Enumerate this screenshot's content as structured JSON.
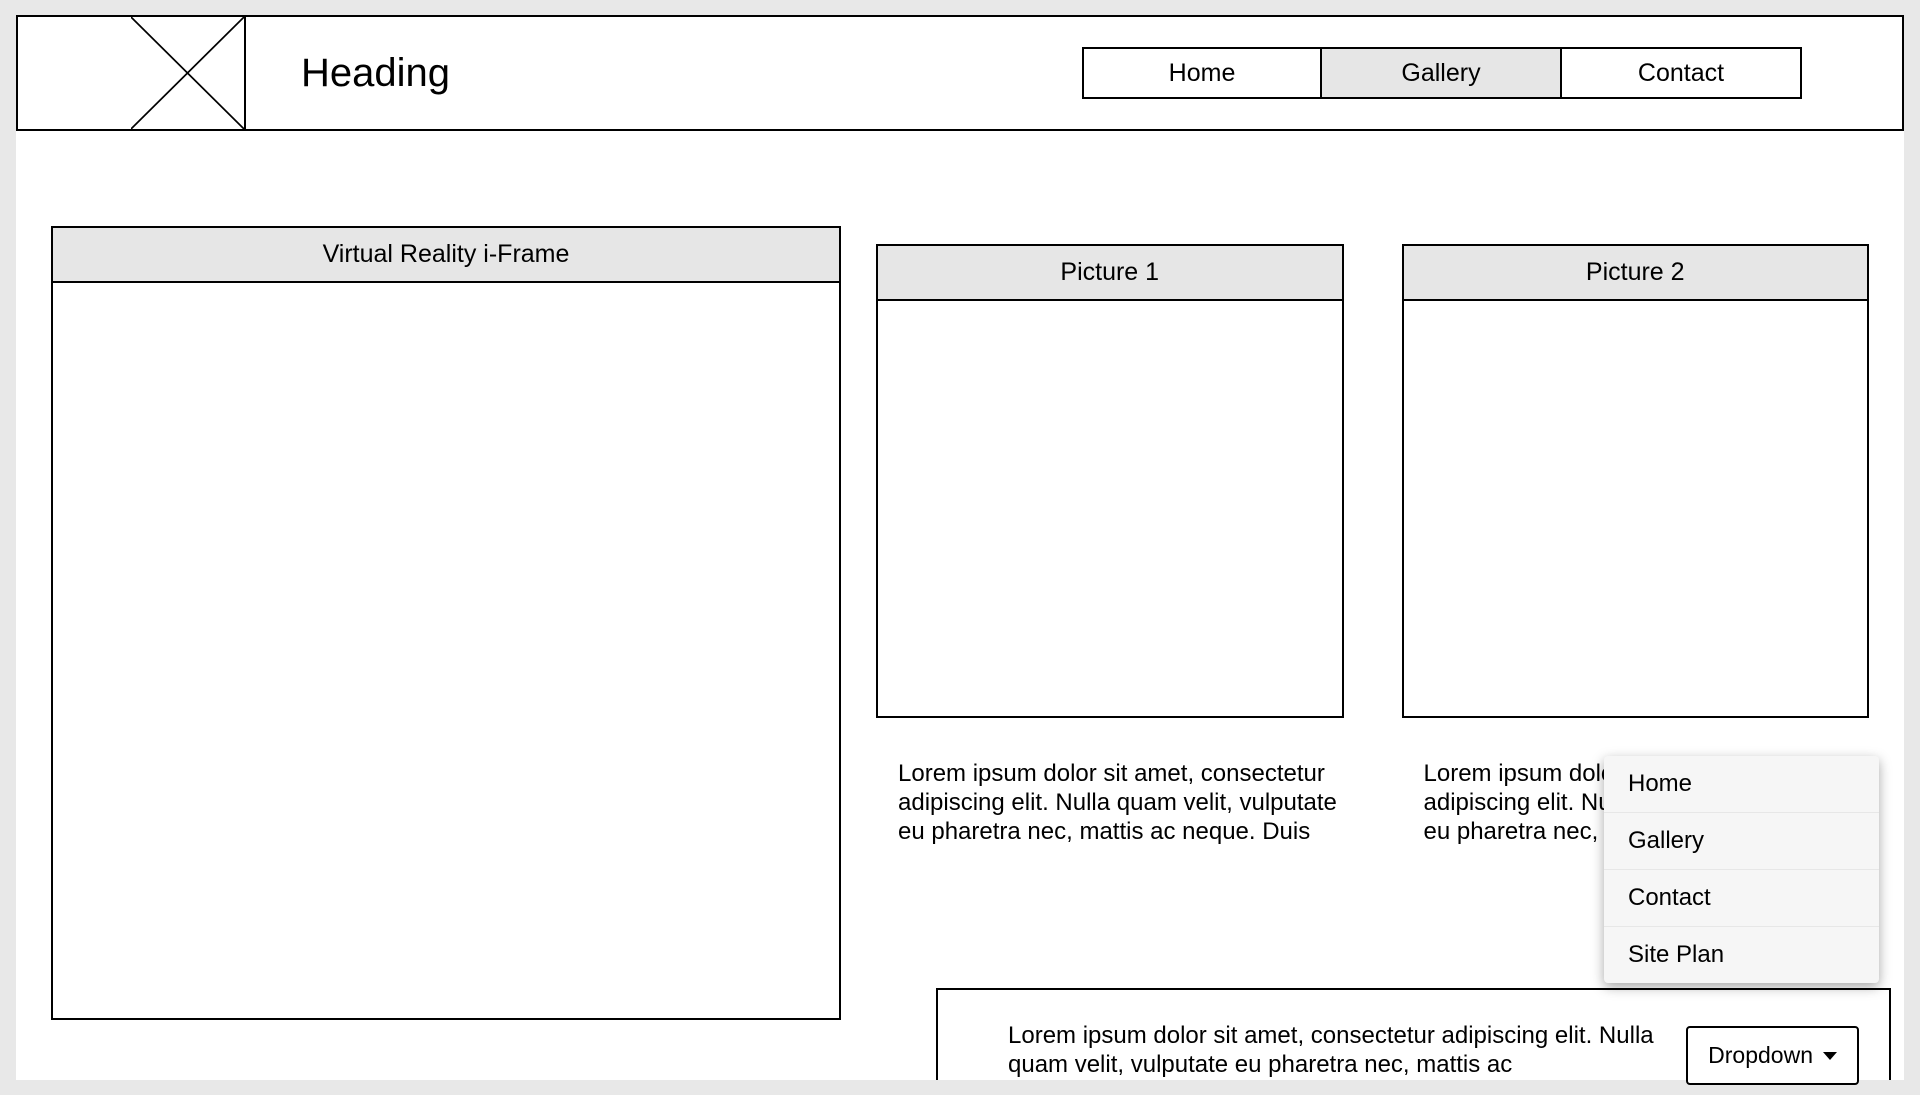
{
  "header": {
    "title": "Heading",
    "nav": [
      {
        "label": "Home",
        "active": false
      },
      {
        "label": "Gallery",
        "active": true
      },
      {
        "label": "Contact",
        "active": false
      }
    ]
  },
  "vr_frame": {
    "title": "Virtual Reality i-Frame"
  },
  "pictures": [
    {
      "title": "Picture 1",
      "text": "Lorem ipsum dolor sit amet, consectetur adipiscing elit. Nulla quam velit, vulputate eu pharetra nec, mattis ac neque. Duis"
    },
    {
      "title": "Picture 2",
      "text": "Lorem ipsum dolor sit amet, consectetur adipiscing elit. Nulla quam velit, vulputate eu pharetra nec, mattis ac neque. Duis"
    }
  ],
  "bottom": {
    "text": "Lorem ipsum dolor sit amet, consectetur adipiscing elit. Nulla quam velit, vulputate eu pharetra nec, mattis ac",
    "dropdown_label": "Dropdown",
    "dropdown_options": [
      {
        "label": "Home"
      },
      {
        "label": "Gallery"
      },
      {
        "label": "Contact"
      },
      {
        "label": "Site Plan"
      }
    ]
  }
}
